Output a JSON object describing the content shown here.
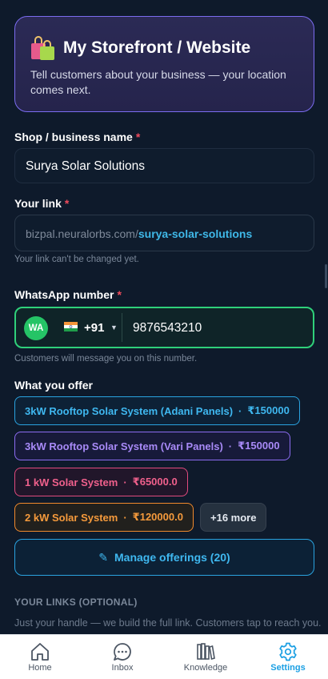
{
  "hero": {
    "title": "My Storefront / Website",
    "subtitle": "Tell customers about your business — your location comes next."
  },
  "business_name": {
    "label": "Shop / business name",
    "required_mark": "*",
    "value": "Surya Solar Solutions"
  },
  "link": {
    "label": "Your link",
    "required_mark": "*",
    "prefix": "bizpal.neuralorbs.com/",
    "slug": "surya-solar-solutions",
    "hint": "Your link can't be changed yet."
  },
  "whatsapp": {
    "label": "WhatsApp number",
    "required_mark": "*",
    "badge": "WA",
    "country_code": "+91",
    "number": "9876543210",
    "hint": "Customers will message you on this number."
  },
  "offerings": {
    "label": "What you offer",
    "separator": "·",
    "items": [
      {
        "name": "3kW Rooftop Solar System (Adani Panels)",
        "price": "₹150000"
      },
      {
        "name": "3kW Rooftop Solar System (Vari Panels)",
        "price": "₹150000"
      },
      {
        "name": "1 kW Solar System",
        "price": "₹65000.0"
      },
      {
        "name": "2 kW Solar System",
        "price": "₹120000.0"
      }
    ],
    "more": "+16 more",
    "manage_icon": "✎",
    "manage_label": "Manage offerings (20)"
  },
  "your_links": {
    "title": "YOUR LINKS (OPTIONAL)",
    "description": "Just your handle — we build the full link. Customers tap to reach you."
  },
  "nav": [
    {
      "label": "Home",
      "icon": "home-icon"
    },
    {
      "label": "Inbox",
      "icon": "chat-icon"
    },
    {
      "label": "Knowledge",
      "icon": "books-icon"
    },
    {
      "label": "Settings",
      "icon": "gear-icon",
      "active": true
    }
  ],
  "colors": {
    "background": "#0e1a2b",
    "accent_purple": "#7b6cf0",
    "accent_blue": "#3fb8f0",
    "whatsapp_green": "#25c466",
    "required_red": "#ef4b5c",
    "nav_active": "#1a9fe3"
  }
}
